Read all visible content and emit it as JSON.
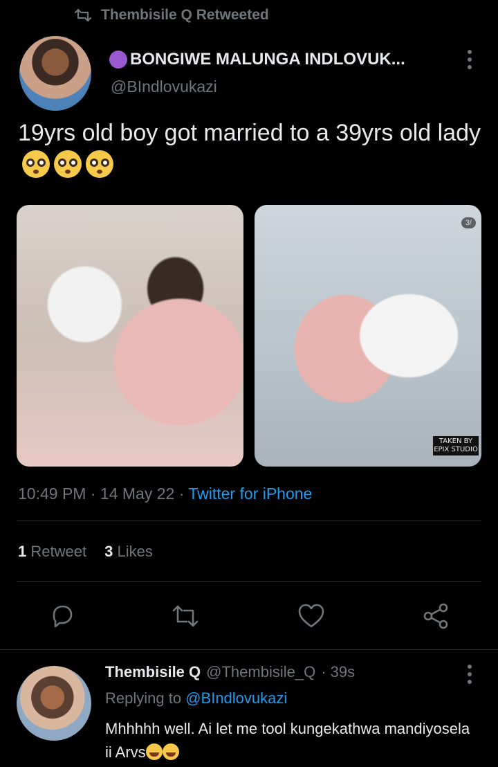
{
  "retweet_banner": {
    "text": "Thembisile Q Retweeted",
    "icon": "retweet-icon"
  },
  "tweet": {
    "author_name": "BONGIWE MALUNGA INDLOVUK...",
    "author_handle": "@BIndlovukazi",
    "text": "19yrs old boy got married to a 39yrs old lady",
    "emojis": [
      "flushed-face",
      "flushed-face",
      "flushed-face"
    ],
    "media": [
      {
        "alt": "photo-1"
      },
      {
        "alt": "photo-2",
        "badge": "3/",
        "watermark": "TAKEN BY EPIX STUDIO"
      }
    ],
    "time": "10:49 PM",
    "date": "14 May 22",
    "separator": "·",
    "source": "Twitter for iPhone",
    "retweet_count": "1",
    "retweet_label": "Retweet",
    "like_count": "3",
    "like_label": "Likes"
  },
  "actions": {
    "reply": "reply-icon",
    "retweet": "retweet-icon",
    "like": "heart-icon",
    "share": "share-icon"
  },
  "reply": {
    "author_name": "Thembisile Q",
    "author_handle": "@Thembisile_Q",
    "age": "· 39s",
    "replying_prefix": "Replying to",
    "replying_handle": "@BIndlovukazi",
    "text": "Mhhhhh well.  Ai let me tool kungekathwa mandiyosela ii Arvs",
    "emojis": [
      "tears-of-joy",
      "tears-of-joy"
    ]
  },
  "colors": {
    "background": "#000000",
    "text": "#e7e9ea",
    "muted": "#71767b",
    "accent": "#1d9bf0",
    "divider": "#2f3336"
  }
}
